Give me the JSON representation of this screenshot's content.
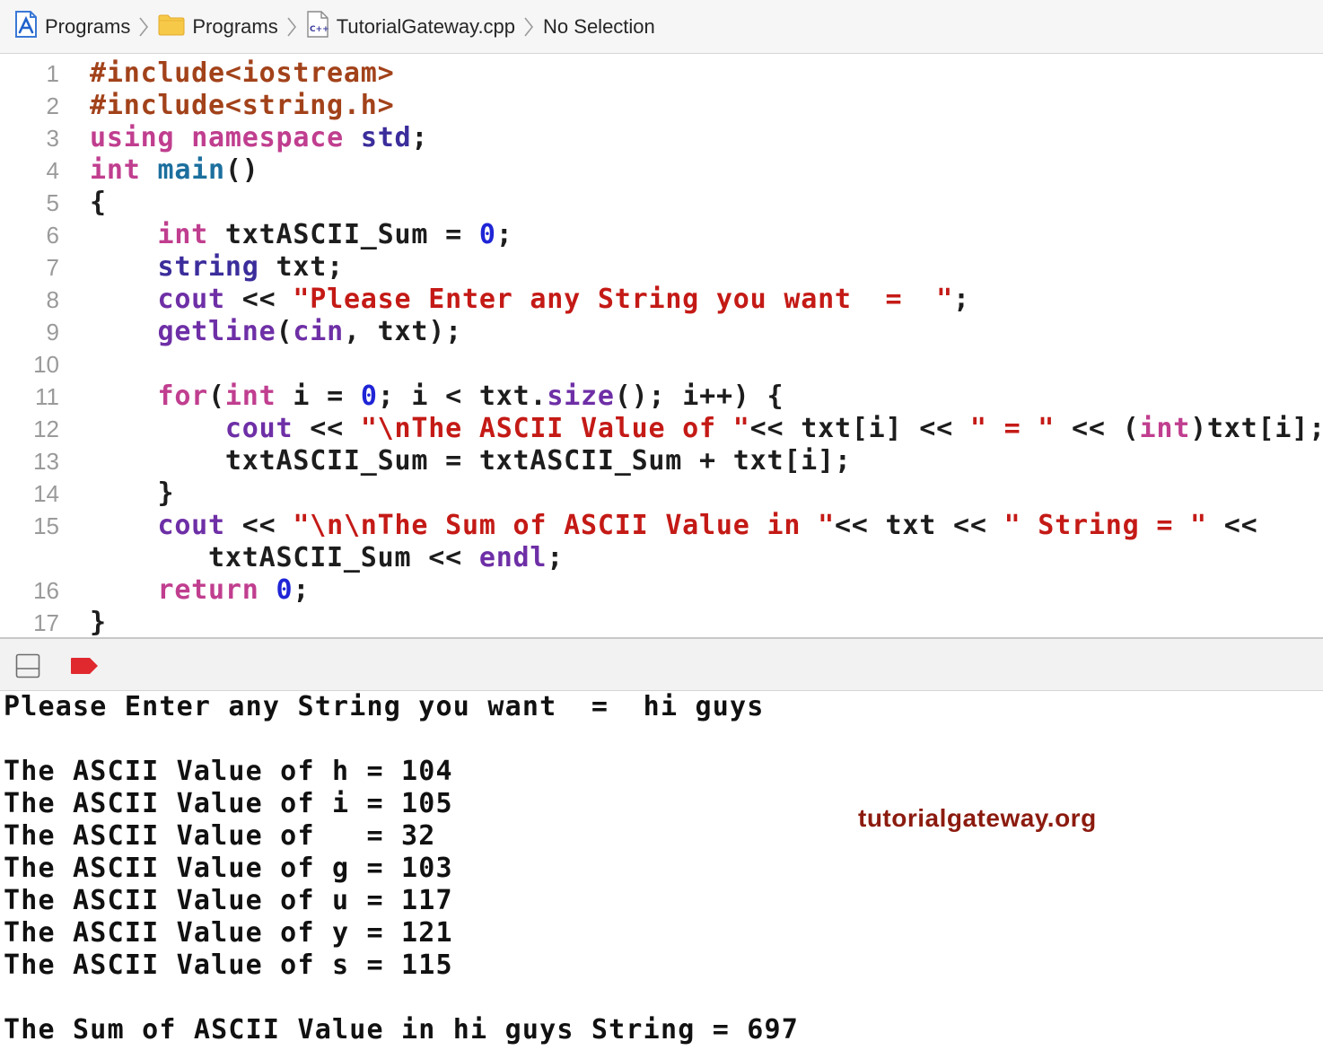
{
  "breadcrumb": {
    "items": [
      {
        "label": "Programs",
        "icon": "xcode-project-icon"
      },
      {
        "label": "Programs",
        "icon": "folder-icon"
      },
      {
        "label": "TutorialGateway.cpp",
        "icon": "cpp-file-icon"
      },
      {
        "label": "No Selection",
        "icon": ""
      }
    ],
    "cpp_badge": "C++"
  },
  "editor": {
    "language": "C++",
    "colors": {
      "preprocessor": "#a2421a",
      "keyword": "#c03e8f",
      "type": "#3b2d9b",
      "function": "#1c6f9e",
      "number": "#1f25d6",
      "string": "#c41a16",
      "identifier": "#1d1d1d",
      "library": "#6e2fa6",
      "line_number": "#9a9a9a"
    },
    "lines": [
      {
        "number": "1",
        "tokens": [
          {
            "t": "#include<iostream>",
            "c": "pre"
          }
        ]
      },
      {
        "number": "2",
        "tokens": [
          {
            "t": "#include<string.h>",
            "c": "pre"
          }
        ]
      },
      {
        "number": "3",
        "tokens": [
          {
            "t": "using",
            "c": "kw"
          },
          {
            "t": " ",
            "c": "id"
          },
          {
            "t": "namespace",
            "c": "kw"
          },
          {
            "t": " ",
            "c": "id"
          },
          {
            "t": "std",
            "c": "ty"
          },
          {
            "t": ";",
            "c": "id"
          }
        ]
      },
      {
        "number": "4",
        "tokens": [
          {
            "t": "int",
            "c": "kw"
          },
          {
            "t": " ",
            "c": "id"
          },
          {
            "t": "main",
            "c": "fn"
          },
          {
            "t": "()",
            "c": "id"
          }
        ]
      },
      {
        "number": "5",
        "tokens": [
          {
            "t": "{",
            "c": "id"
          }
        ]
      },
      {
        "number": "6",
        "tokens": [
          {
            "t": "    ",
            "c": "id"
          },
          {
            "t": "int",
            "c": "kw"
          },
          {
            "t": " txtASCII_Sum = ",
            "c": "id"
          },
          {
            "t": "0",
            "c": "num"
          },
          {
            "t": ";",
            "c": "id"
          }
        ]
      },
      {
        "number": "7",
        "tokens": [
          {
            "t": "    ",
            "c": "id"
          },
          {
            "t": "string",
            "c": "ty"
          },
          {
            "t": " txt;",
            "c": "id"
          }
        ]
      },
      {
        "number": "8",
        "tokens": [
          {
            "t": "    ",
            "c": "id"
          },
          {
            "t": "cout",
            "c": "lib"
          },
          {
            "t": " << ",
            "c": "id"
          },
          {
            "t": "\"Please Enter any String you want  =  \"",
            "c": "str"
          },
          {
            "t": ";",
            "c": "id"
          }
        ]
      },
      {
        "number": "9",
        "tokens": [
          {
            "t": "    ",
            "c": "id"
          },
          {
            "t": "getline",
            "c": "lib"
          },
          {
            "t": "(",
            "c": "id"
          },
          {
            "t": "cin",
            "c": "lib"
          },
          {
            "t": ", txt);",
            "c": "id"
          }
        ]
      },
      {
        "number": "10",
        "tokens": []
      },
      {
        "number": "11",
        "tokens": [
          {
            "t": "    ",
            "c": "id"
          },
          {
            "t": "for",
            "c": "kw"
          },
          {
            "t": "(",
            "c": "id"
          },
          {
            "t": "int",
            "c": "kw"
          },
          {
            "t": " i = ",
            "c": "id"
          },
          {
            "t": "0",
            "c": "num"
          },
          {
            "t": "; i < txt.",
            "c": "id"
          },
          {
            "t": "size",
            "c": "lib"
          },
          {
            "t": "(); i++) {",
            "c": "id"
          }
        ]
      },
      {
        "number": "12",
        "tokens": [
          {
            "t": "        ",
            "c": "id"
          },
          {
            "t": "cout",
            "c": "lib"
          },
          {
            "t": " << ",
            "c": "id"
          },
          {
            "t": "\"\\nThe ASCII Value of \"",
            "c": "str"
          },
          {
            "t": "<< txt[i] << ",
            "c": "id"
          },
          {
            "t": "\" = \"",
            "c": "str"
          },
          {
            "t": " << (",
            "c": "id"
          },
          {
            "t": "int",
            "c": "kw"
          },
          {
            "t": ")txt[i];",
            "c": "id"
          }
        ]
      },
      {
        "number": "13",
        "tokens": [
          {
            "t": "        txtASCII_Sum = txtASCII_Sum + txt[i];",
            "c": "id"
          }
        ]
      },
      {
        "number": "14",
        "tokens": [
          {
            "t": "    }",
            "c": "id"
          }
        ]
      },
      {
        "number": "15",
        "tokens": [
          {
            "t": "    ",
            "c": "id"
          },
          {
            "t": "cout",
            "c": "lib"
          },
          {
            "t": " << ",
            "c": "id"
          },
          {
            "t": "\"\\n\\nThe Sum of ASCII Value in \"",
            "c": "str"
          },
          {
            "t": "<< txt << ",
            "c": "id"
          },
          {
            "t": "\" String = \"",
            "c": "str"
          },
          {
            "t": " <<",
            "c": "id"
          }
        ]
      },
      {
        "number": "",
        "tokens": [
          {
            "t": "       txtASCII_Sum << ",
            "c": "id"
          },
          {
            "t": "endl",
            "c": "lib"
          },
          {
            "t": ";",
            "c": "id"
          }
        ]
      },
      {
        "number": "16",
        "tokens": [
          {
            "t": "    ",
            "c": "id"
          },
          {
            "t": "return",
            "c": "kw"
          },
          {
            "t": " ",
            "c": "id"
          },
          {
            "t": "0",
            "c": "num"
          },
          {
            "t": ";",
            "c": "id"
          }
        ]
      },
      {
        "number": "17",
        "tokens": [
          {
            "t": "}",
            "c": "id"
          }
        ]
      }
    ]
  },
  "debug_bar": {
    "hide_area_icon": "hide-debug-area-icon",
    "breakpoint_icon": "breakpoint-toggle-icon",
    "breakpoint_color": "#e0282f"
  },
  "console": {
    "lines": [
      "Please Enter any String you want  =  hi guys",
      "",
      "The ASCII Value of h = 104",
      "The ASCII Value of i = 105",
      "The ASCII Value of   = 32",
      "The ASCII Value of g = 103",
      "The ASCII Value of u = 117",
      "The ASCII Value of y = 121",
      "The ASCII Value of s = 115",
      "",
      "The Sum of ASCII Value in hi guys String = 697"
    ],
    "watermark": "tutorialgateway.org"
  }
}
